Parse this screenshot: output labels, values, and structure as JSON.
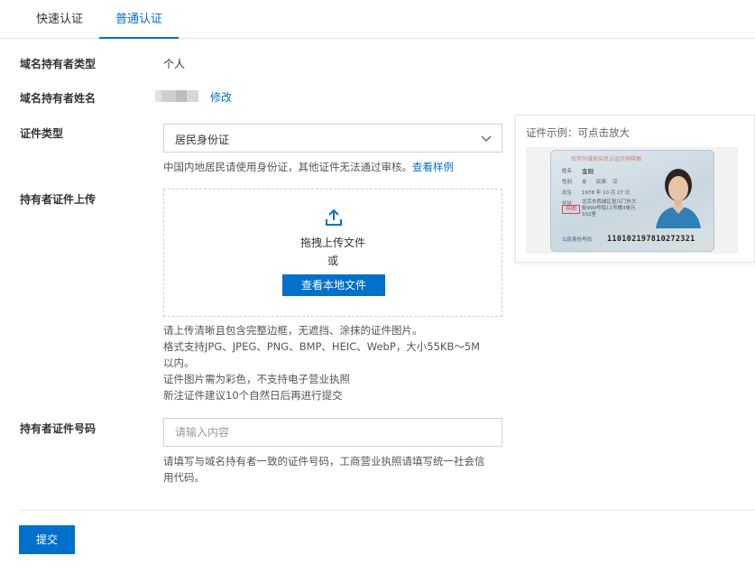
{
  "tabs": [
    {
      "label": "快速认证",
      "active": false
    },
    {
      "label": "普通认证",
      "active": true
    }
  ],
  "form": {
    "holder_type": {
      "label": "域名持有者类型",
      "value": "个人"
    },
    "holder_name": {
      "label": "域名持有者姓名",
      "edit_link": "修改"
    },
    "id_type": {
      "label": "证件类型",
      "selected": "居民身份证",
      "hint": "中国内地居民请使用身份证，其他证件无法通过审核。",
      "hint_link": "查看样例"
    },
    "upload": {
      "label": "持有者证件上传",
      "drag_text": "拖拽上传文件",
      "or_text": "或",
      "button_label": "查看本地文件",
      "hints": [
        "请上传清晰且包含完整边框，无遮挡、涂抹的证件图片。",
        "格式支持JPG、JPEG、PNG、BMP、HEIC、WebP，大小55KB～5M",
        "以内。",
        "证件图片需为彩色，不支持电子营业执照",
        "新注证件建议10个自然日后再进行提交"
      ]
    },
    "id_number": {
      "label": "持有者证件号码",
      "placeholder": "请输入内容",
      "hint_lines": [
        "请填写与域名持有者一致的证件号码，工商营业执照请填写统一社会信",
        "用代码。"
      ]
    },
    "submit_label": "提交"
  },
  "example": {
    "title": "证件示例：可点击放大",
    "card": {
      "header": "仅作为域名实名认证示例样图",
      "name_label": "姓名",
      "name": "金刚",
      "sex_label": "性别",
      "sex": "女",
      "ethnicity_label": "民族",
      "ethnicity": "汉",
      "birth_label": "出生",
      "birth": "1978 年 10 月 27 日",
      "address_label": "住址",
      "address_lines": [
        "北京市西城区复兴门外大",
        "街999号院11号楼3单元",
        "502室"
      ],
      "stamp": "样图",
      "id_label": "公民身份号码",
      "id_number": "110102197810272321"
    }
  },
  "colors": {
    "accent": "#0070cc",
    "border": "#d1d1d1",
    "muted": "#999999"
  }
}
